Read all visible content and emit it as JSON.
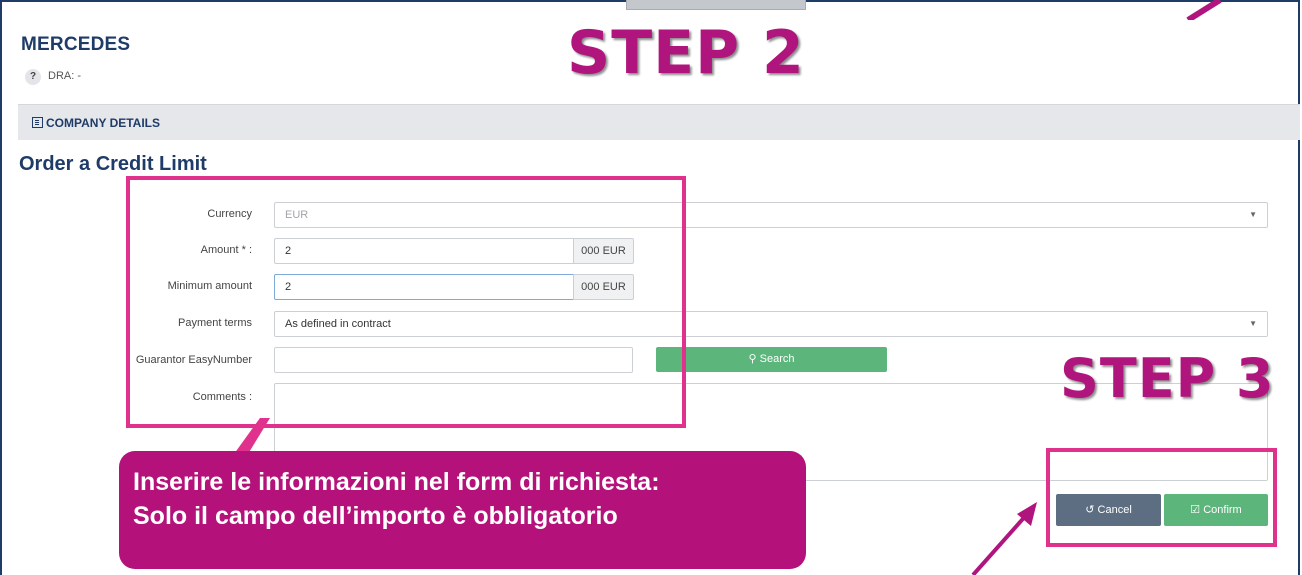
{
  "header": {
    "company_name": "MERCEDES",
    "help_glyph": "?",
    "dra_label": "DRA: -"
  },
  "details_bar": {
    "label": "COMPANY DETAILS",
    "icon": "building-icon"
  },
  "form": {
    "title": "Order a Credit Limit",
    "currency": {
      "label": "Currency",
      "value": "EUR"
    },
    "amount": {
      "label": "Amount * :",
      "value": "2",
      "suffix": "000 EUR"
    },
    "minimum_amount": {
      "label": "Minimum amount",
      "value": "2",
      "suffix": "000 EUR"
    },
    "payment_terms": {
      "label": "Payment terms",
      "value": "As defined in contract"
    },
    "guarantor": {
      "label": "Guarantor EasyNumber",
      "value": ""
    },
    "search_button": "Search",
    "comments": {
      "label": "Comments :",
      "value": ""
    },
    "cancel_button": "Cancel",
    "confirm_button": "Confirm"
  },
  "annotations": {
    "step2": "STEP 2",
    "step3": "STEP 3",
    "callout_line1": "Inserire le informazioni nel form di richiesta:",
    "callout_line2": "Solo il campo dell’importo è obbligatorio",
    "highlight_color": "#e0328c",
    "callout_color": "#b5117a"
  }
}
